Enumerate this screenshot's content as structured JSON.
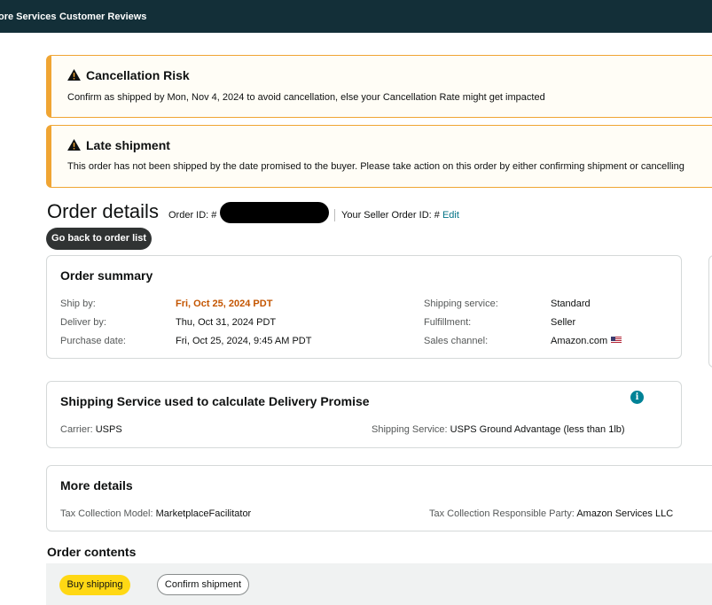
{
  "nav": {
    "items": [
      "ore Services",
      "Customer Reviews"
    ]
  },
  "alerts": [
    {
      "title": "Cancellation Risk",
      "message": "Confirm as shipped by Mon, Nov 4, 2024 to avoid cancellation, else your Cancellation Rate might get impacted"
    },
    {
      "title": "Late shipment",
      "message": "This order has not been shipped by the date promised to the buyer. Please take action on this order by either confirming shipment or cancelling"
    }
  ],
  "order": {
    "title": "Order details",
    "order_id_label": "Order ID: #",
    "seller_order_id_label": "Your Seller Order ID: #",
    "edit_link": "Edit",
    "back_button": "Go back to order list"
  },
  "summary": {
    "title": "Order summary",
    "left": [
      {
        "label": "Ship by:",
        "value": "Fri, Oct 25, 2024 PDT"
      },
      {
        "label": "Deliver by:",
        "value": "Thu, Oct 31, 2024 PDT"
      },
      {
        "label": "Purchase date:",
        "value": "Fri, Oct 25, 2024, 9:45 AM PDT"
      }
    ],
    "right": [
      {
        "label": "Shipping service:",
        "value": "Standard"
      },
      {
        "label": "Fulfillment:",
        "value": "Seller"
      },
      {
        "label": "Sales channel:",
        "value": "Amazon.com"
      }
    ]
  },
  "shipping": {
    "title": "Shipping Service used to calculate Delivery Promise",
    "info_icon": "i",
    "carrier_label": "Carrier:",
    "carrier_value": "USPS",
    "service_label": "Shipping Service:",
    "service_value": "USPS Ground Advantage (less than 1lb)"
  },
  "more": {
    "title": "More details",
    "tax_model_label": "Tax Collection Model:",
    "tax_model_value": "MarketplaceFacilitator",
    "tax_party_label": "Tax Collection Responsible Party:",
    "tax_party_value": "Amazon Services LLC"
  },
  "contents": {
    "title": "Order contents",
    "buy_shipping": "Buy shipping",
    "confirm_shipment": "Confirm shipment"
  },
  "colors": {
    "nav_bg": "#132f38",
    "warning": "#f0a533",
    "ship_by": "#c45500",
    "link": "#007185",
    "buy_button": "#ffd814"
  },
  "icons": {
    "alert_icon": "warning-triangle-icon",
    "info_icon": "info-icon",
    "flag_icon": "us-flag-icon"
  }
}
